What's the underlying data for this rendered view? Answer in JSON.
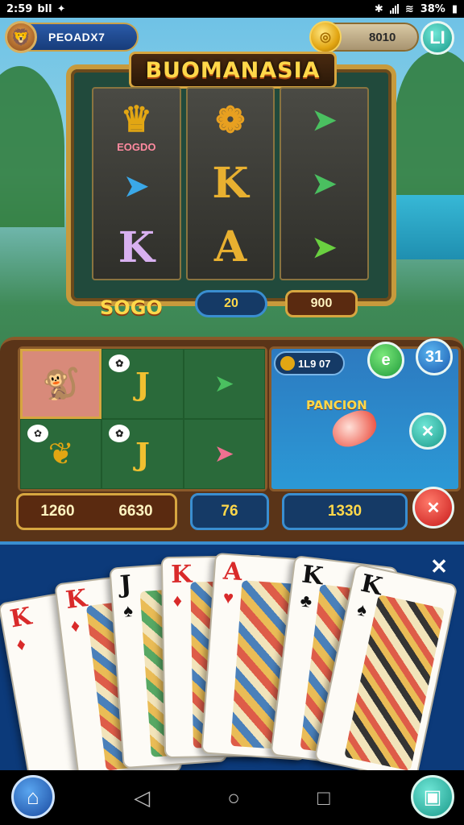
{
  "status_bar": {
    "time": "2:59",
    "carrier": "bll",
    "battery": "38%"
  },
  "hud": {
    "player_name": "PEOADX7",
    "coins": "8010",
    "menu_label": "LI"
  },
  "machine": {
    "title": "BUOMANASIA",
    "bet_label": "SOGO",
    "bet_value": "20",
    "win_value": "900",
    "symbol_caption": "EOGDO"
  },
  "table": {
    "pond_chip": "1L9 07",
    "pond_title": "PANCION",
    "score_left_a": "1260",
    "score_left_b": "6630",
    "score_mid": "76",
    "score_right": "1330",
    "btn_e": "e",
    "btn_31": "31",
    "btn_x1": "✕",
    "btn_x2": "✕"
  },
  "hand": {
    "close": "✕",
    "cards": [
      {
        "rank": "K",
        "suit": "♦",
        "color": "red"
      },
      {
        "rank": "K",
        "suit": "♦",
        "color": "red"
      },
      {
        "rank": "J",
        "suit": "♠",
        "color": "black"
      },
      {
        "rank": "K",
        "suit": "♦",
        "color": "red"
      },
      {
        "rank": "A",
        "suit": "♥",
        "color": "red"
      },
      {
        "rank": "K",
        "suit": "♣",
        "color": "black"
      },
      {
        "rank": "K",
        "suit": "♠",
        "color": "black"
      }
    ]
  },
  "nav": {
    "back": "◁",
    "home": "○",
    "recents": "□"
  },
  "colors": {
    "gold": "#ffd84a",
    "wood": "#5a3418",
    "felt": "#2a6a3a",
    "water": "#2b99d6",
    "hand_bg": "#0c3a7a"
  },
  "icons": [
    "avatar-icon",
    "coin-icon",
    "fish-icon",
    "close-icon",
    "home-icon",
    "back-icon",
    "recents-icon"
  ]
}
